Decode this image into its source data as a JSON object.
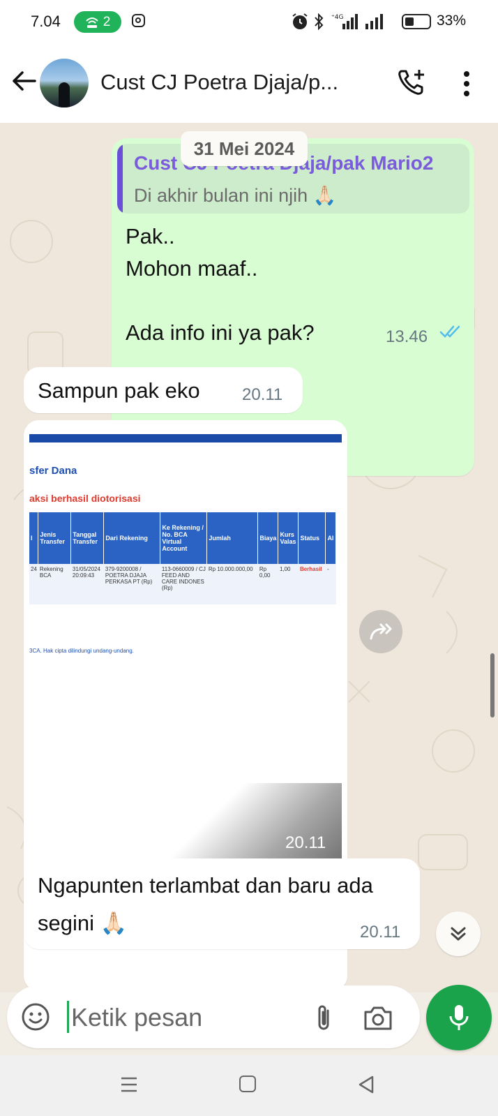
{
  "status_bar": {
    "time": "7.04",
    "hotspot_count": "2",
    "battery": "33%",
    "icons": [
      "hotspot-icon",
      "instagram-icon",
      "alarm-icon",
      "bluetooth-icon",
      "signal-4g-icon",
      "signal-icon",
      "battery-icon"
    ]
  },
  "header": {
    "title": "Cust CJ Poetra Djaja/p...",
    "icons": [
      "back-arrow-icon",
      "add-call-icon",
      "more-vert-icon"
    ]
  },
  "chat": {
    "date_chip": "31 Mei 2024",
    "outgoing": {
      "quote_author": "Cust CJ Poetra Djaja/pak Mario2",
      "quote_text": "Di akhir bulan ini njih 🙏🏻",
      "text": "Pak..\nMohon maaf..\n\nAda info ini ya pak?",
      "time": "13.46",
      "ticks": "read"
    },
    "incoming_1": {
      "text": "Sampun pak eko",
      "time": "20.11"
    },
    "image_message": {
      "time": "20.11",
      "screenshot": {
        "heading": "sfer Dana",
        "subheading": "aksi berhasil diotorisasi",
        "columns": [
          "l",
          "Jenis Transfer",
          "Tanggal Transfer",
          "Dari Rekening",
          "Ke Rekening / No. BCA Virtual Account",
          "Jumlah",
          "Biaya",
          "Kurs Valas",
          "Status",
          "Al"
        ],
        "row": [
          "24",
          "Rekening BCA",
          "31/05/2024 20:09:43",
          "379-9200008 / POETRA DJAJA PERKASA PT (Rp)",
          "113-0660009 / CJ FEED AND CARE INDONES (Rp)",
          "Rp 10.000.000,00",
          "Rp 0,00",
          "1,00",
          "Berhasil",
          "-"
        ],
        "footer": "3CA. Hak cipta dilindungi undang-undang."
      }
    },
    "incoming_2": {
      "text": "Ngapunten terlambat dan baru ada segini 🙏🏻",
      "time": "20.11"
    }
  },
  "composer": {
    "placeholder": "Ketik pesan",
    "icons": [
      "emoji-icon",
      "attach-icon",
      "camera-icon",
      "mic-icon"
    ]
  },
  "colors": {
    "outgoing_bubble": "#d9fdd3",
    "incoming_bubble": "#ffffff",
    "accent_green": "#1aa34a",
    "quote_purple": "#7a5bdc",
    "tick_blue": "#53bdeb"
  }
}
